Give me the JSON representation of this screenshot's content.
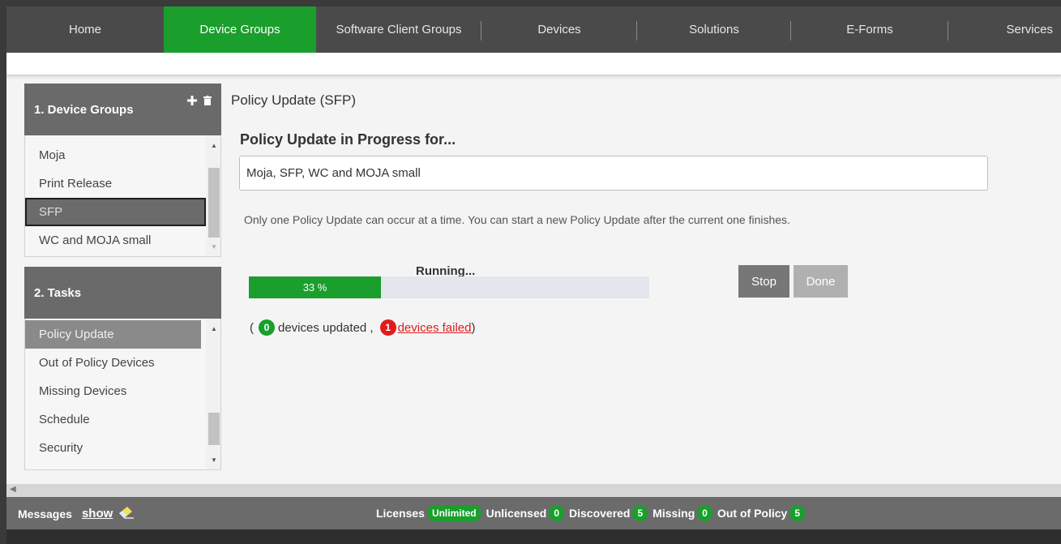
{
  "nav": {
    "items": [
      {
        "label": "Home"
      },
      {
        "label": "Device Groups"
      },
      {
        "label": "Software Client Groups"
      },
      {
        "label": "Devices"
      },
      {
        "label": "Solutions"
      },
      {
        "label": "E-Forms"
      },
      {
        "label": "Services"
      }
    ],
    "active": "Device Groups"
  },
  "device_groups": {
    "title": "1. Device Groups",
    "items": [
      {
        "label": "Moja"
      },
      {
        "label": "Print Release"
      },
      {
        "label": "SFP"
      },
      {
        "label": "WC and MOJA small"
      }
    ],
    "selected": "SFP"
  },
  "tasks": {
    "title": "2. Tasks",
    "items": [
      {
        "label": "Policy Update"
      },
      {
        "label": "Out of Policy Devices"
      },
      {
        "label": "Missing Devices"
      },
      {
        "label": "Schedule"
      },
      {
        "label": "Security"
      }
    ],
    "selected": "Policy Update"
  },
  "main": {
    "title": "Policy Update (SFP)",
    "heading": "Policy Update in Progress for...",
    "groups_value": "Moja, SFP, WC and MOJA small",
    "notice": "Only one Policy Update can occur at a time. You can start a new Policy Update after the current one finishes.",
    "status": "Running...",
    "progress_label": "33 %",
    "progress_fraction": 0.33,
    "stop_label": "Stop",
    "done_label": "Done",
    "result": {
      "open_paren": "(",
      "updated_count": "0",
      "updated_text": "devices updated ,",
      "failed_count": "1",
      "failed_text": " devices failed",
      "close_paren": ")"
    }
  },
  "footer": {
    "messages_label": "Messages",
    "show_label": "show",
    "licenses_label": "Licenses",
    "licenses_value": "Unlimited",
    "unlicensed_label": "Unlicensed",
    "unlicensed_value": "0",
    "discovered_label": "Discovered",
    "discovered_value": "5",
    "missing_label": "Missing",
    "missing_value": "0",
    "out_of_policy_label": "Out of Policy",
    "out_of_policy_value": "5"
  },
  "colors": {
    "accent_green": "#1a9e2c",
    "fail_red": "#e01c1c",
    "nav_bg": "#4a4a4a"
  }
}
